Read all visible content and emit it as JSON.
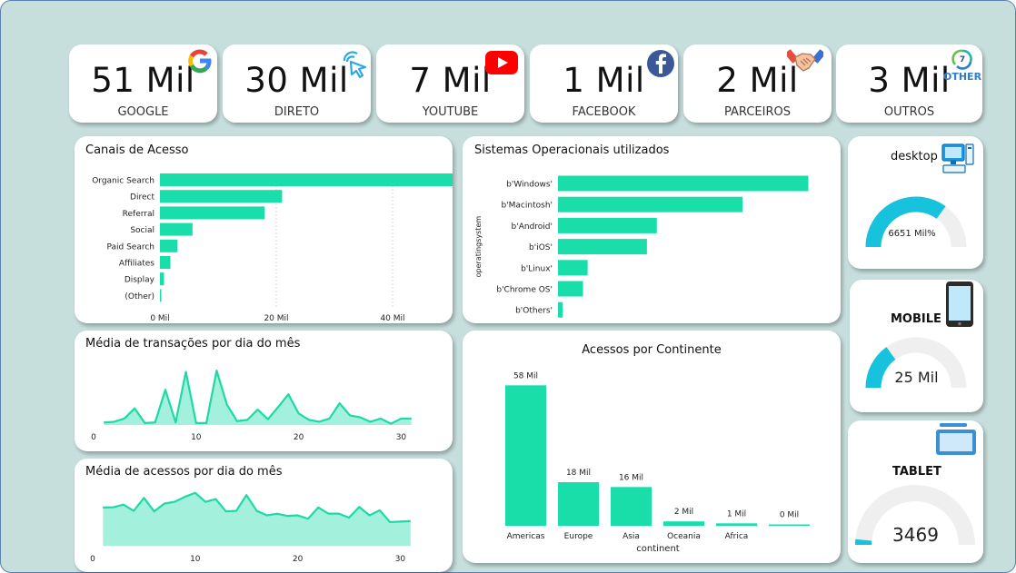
{
  "kpis": [
    {
      "value": "51 Mil",
      "label": "GOOGLE",
      "icon": "google-icon"
    },
    {
      "value": "30 Mil",
      "label": "DIRETO",
      "icon": "cursor-click-icon"
    },
    {
      "value": "7 Mil",
      "label": "YOUTUBE",
      "icon": "youtube-icon"
    },
    {
      "value": "1 Mil",
      "label": "FACEBOOK",
      "icon": "facebook-icon"
    },
    {
      "value": "2 Mil",
      "label": "PARCEIROS",
      "icon": "handshake-icon"
    },
    {
      "value": "3 Mil",
      "label": "OUTROS",
      "icon": "other-icon",
      "icon_text": "OTHER",
      "icon_number": "7"
    }
  ],
  "colors": {
    "bar": "#19deaa",
    "area_fill": "#a3f0dc",
    "line": "#1fd9a5",
    "gauge": "#17c2dc",
    "gauge_track": "#efefef",
    "frame": "#c6dedc"
  },
  "chart_data": [
    {
      "id": "canais",
      "type": "bar",
      "orientation": "horizontal",
      "title": "Canais de Acesso",
      "categories": [
        "Organic Search",
        "Direct",
        "Referral",
        "Social",
        "Paid Search",
        "Affiliates",
        "Display",
        "(Other)"
      ],
      "values": [
        53000,
        21000,
        18000,
        5600,
        3000,
        1800,
        700,
        120
      ],
      "xlim": [
        0,
        50000
      ],
      "xticks": [
        0,
        20000,
        40000
      ],
      "xtick_labels": [
        "0 Mil",
        "20 Mil",
        "40 Mil"
      ],
      "grid": true
    },
    {
      "id": "sistemas",
      "type": "bar",
      "orientation": "horizontal",
      "title": "Sistemas Operacionais utilizados",
      "ylabel": "operatingsystem",
      "categories": [
        "b'Windows'",
        "b'Macintosh'",
        "b'Android'",
        "b'iOS'",
        "b'Linux'",
        "b'Chrome OS'",
        "b'Others'"
      ],
      "values": [
        38000,
        28000,
        15000,
        13500,
        4500,
        3800,
        700
      ],
      "xlim": [
        0,
        40000
      ]
    },
    {
      "id": "transacoes",
      "type": "area",
      "title": "Média de transações por dia do mês",
      "x": [
        1,
        2,
        3,
        4,
        5,
        6,
        7,
        8,
        9,
        10,
        11,
        12,
        13,
        14,
        15,
        16,
        17,
        18,
        19,
        20,
        21,
        22,
        23,
        24,
        25,
        26,
        27,
        28,
        29,
        30,
        31
      ],
      "y": [
        0.4,
        0.5,
        1.0,
        2.6,
        0.3,
        0.4,
        5.5,
        0.4,
        8.3,
        0.3,
        0.3,
        8.5,
        3.2,
        0.6,
        0.8,
        2.4,
        0.9,
        2.8,
        4.8,
        1.8,
        0.8,
        0.5,
        1.0,
        3.4,
        1.5,
        1.2,
        0.5,
        1.0,
        0.2,
        1.0,
        1.0
      ],
      "xticks": [
        0,
        10,
        20,
        30
      ],
      "xlim": [
        0,
        32
      ],
      "ylim": [
        0,
        9.5
      ]
    },
    {
      "id": "acessos_dia",
      "type": "area",
      "title": "Média de acessos por dia do mês",
      "x": [
        1,
        2,
        3,
        4,
        5,
        6,
        7,
        8,
        9,
        10,
        11,
        12,
        13,
        14,
        15,
        16,
        17,
        18,
        19,
        20,
        21,
        22,
        23,
        24,
        25,
        26,
        27,
        28,
        29,
        30,
        31
      ],
      "y": [
        3400,
        3420,
        3650,
        3100,
        4250,
        3050,
        3750,
        3900,
        4350,
        4700,
        3900,
        4150,
        3050,
        3100,
        4500,
        3100,
        2700,
        2850,
        2650,
        2700,
        2400,
        3400,
        2850,
        2850,
        2500,
        3450,
        2700,
        3150,
        2100,
        2150,
        2200
      ],
      "xticks": [
        0,
        10,
        20,
        30
      ],
      "xlim": [
        0,
        32
      ],
      "ylim": [
        0,
        5000
      ]
    },
    {
      "id": "continentes",
      "type": "bar",
      "title": "Acessos por Continente",
      "xlabel": "continent",
      "categories": [
        "Americas",
        "Europe",
        "Asia",
        "Oceania",
        "Africa",
        ""
      ],
      "values": [
        58000,
        18000,
        16000,
        1800,
        1000,
        150
      ],
      "data_labels": [
        "58 Mil",
        "18 Mil",
        "16 Mil",
        "2 Mil",
        "1 Mil",
        "0 Mil"
      ],
      "ylim": [
        0,
        60000
      ]
    }
  ],
  "gauges": [
    {
      "title": "desktop",
      "value_label": "6651 Mil%",
      "fraction": 0.7,
      "icon": "desktop-computer-icon"
    },
    {
      "title": "MOBILE",
      "value_label": "25 Mil",
      "fraction": 0.3,
      "icon": "smartphone-icon"
    },
    {
      "title": "TABLET",
      "value_label": "3469",
      "fraction": 0.03,
      "icon": "tablet-icon"
    }
  ]
}
